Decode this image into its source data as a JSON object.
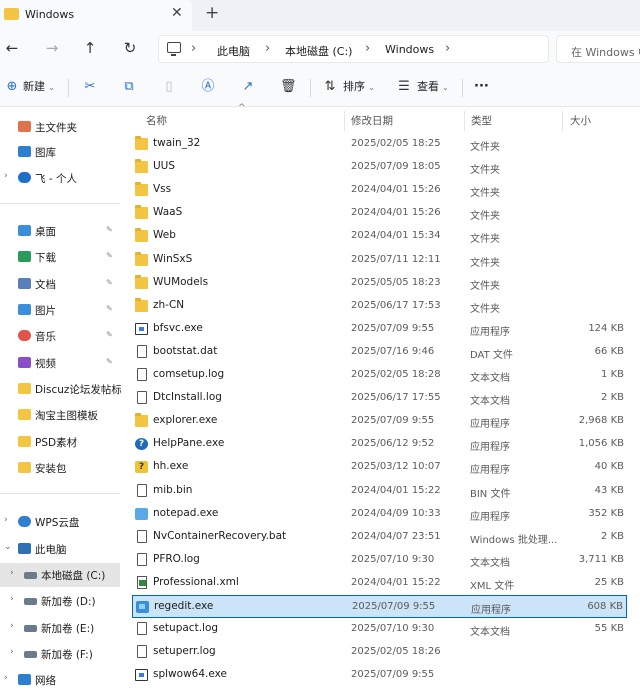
{
  "window": {
    "tab_title": "Windows",
    "tab_close": "✕",
    "tab_add": "+"
  },
  "nav": {
    "back_icon": "←",
    "forward_icon": "→",
    "up_icon": "↑",
    "refresh_icon": "↻"
  },
  "address": {
    "breadcrumbs": [
      "此电脑",
      "本地磁盘 (C:)",
      "Windows"
    ],
    "separator": "›"
  },
  "search": {
    "placeholder": "在 Windows 中搜索"
  },
  "toolbar": {
    "new_label": "新建",
    "sort_label": "排序",
    "view_label": "查看",
    "more_label": "···",
    "cut_icon": "✂",
    "copy_icon": "⧉",
    "paste_icon": "📋",
    "rename_icon": "Ⓐ",
    "share_icon": "↗",
    "delete_icon": "🗑"
  },
  "sidebar": {
    "items": [
      {
        "label": "主文件夹",
        "icon": "home-icon",
        "color": "#e0734a"
      },
      {
        "label": "图库",
        "icon": "gallery-icon",
        "color": "#2f7fd1"
      },
      {
        "label": "飞 - 个人",
        "icon": "onedrive-icon",
        "color": "#1e6fc6",
        "expander": "›"
      },
      {
        "label": "桌面",
        "icon": "desktop-icon",
        "color": "#3a8fd8",
        "pinned": true
      },
      {
        "label": "下载",
        "icon": "download-icon",
        "color": "#2b9a5a",
        "pinned": true
      },
      {
        "label": "文档",
        "icon": "documents-icon",
        "color": "#5a7fb8",
        "pinned": true
      },
      {
        "label": "图片",
        "icon": "pictures-icon",
        "color": "#3a8fd8",
        "pinned": true
      },
      {
        "label": "音乐",
        "icon": "music-icon",
        "color": "#e0544a",
        "pinned": true
      },
      {
        "label": "视频",
        "icon": "videos-icon",
        "color": "#8a4fc8",
        "pinned": true
      },
      {
        "label": "Discuz论坛发帖标题",
        "icon": "folder-icon",
        "color": "#f4c542"
      },
      {
        "label": "淘宝主图模板",
        "icon": "folder-icon",
        "color": "#f4c542"
      },
      {
        "label": "PSD素材",
        "icon": "folder-icon",
        "color": "#f4c542"
      },
      {
        "label": "安装包",
        "icon": "folder-icon",
        "color": "#f4c542"
      },
      {
        "label": "WPS云盘",
        "icon": "cloud-icon",
        "color": "#2f7fd1",
        "expander": "›"
      },
      {
        "label": "此电脑",
        "icon": "pc-icon",
        "color": "#2f6fb5",
        "expander": "⌄"
      },
      {
        "label": "本地磁盘 (C:)",
        "icon": "drive-icon",
        "color": "#6a7b8c",
        "expander": "›",
        "selected": true
      },
      {
        "label": "新加卷 (D:)",
        "icon": "drive-icon",
        "color": "#6a7b8c",
        "expander": "›"
      },
      {
        "label": "新加卷 (E:)",
        "icon": "drive-icon",
        "color": "#6a7b8c",
        "expander": "›"
      },
      {
        "label": "新加卷 (F:)",
        "icon": "drive-icon",
        "color": "#6a7b8c",
        "expander": "›"
      },
      {
        "label": "网络",
        "icon": "network-icon",
        "color": "#2f7fd1",
        "expander": "›"
      }
    ],
    "pin_icon": "📌"
  },
  "list": {
    "columns": {
      "name": "名称",
      "modified": "修改日期",
      "type": "类型",
      "size": "大小"
    },
    "sort_caret": "^",
    "rows": [
      {
        "name": "twain_32",
        "date": "2025/02/05 18:25",
        "type": "文件夹",
        "size": "",
        "icon": "folder"
      },
      {
        "name": "UUS",
        "date": "2025/07/09 18:05",
        "type": "文件夹",
        "size": "",
        "icon": "folder"
      },
      {
        "name": "Vss",
        "date": "2024/04/01 15:26",
        "type": "文件夹",
        "size": "",
        "icon": "folder"
      },
      {
        "name": "WaaS",
        "date": "2024/04/01 15:26",
        "type": "文件夹",
        "size": "",
        "icon": "folder"
      },
      {
        "name": "Web",
        "date": "2024/04/01 15:34",
        "type": "文件夹",
        "size": "",
        "icon": "folder"
      },
      {
        "name": "WinSxS",
        "date": "2025/07/11 12:11",
        "type": "文件夹",
        "size": "",
        "icon": "folder"
      },
      {
        "name": "WUModels",
        "date": "2025/05/05 18:23",
        "type": "文件夹",
        "size": "",
        "icon": "folder"
      },
      {
        "name": "zh-CN",
        "date": "2025/06/17 17:53",
        "type": "文件夹",
        "size": "",
        "icon": "folder"
      },
      {
        "name": "bfsvc.exe",
        "date": "2025/07/09 9:55",
        "type": "应用程序",
        "size": "124 KB",
        "icon": "exe"
      },
      {
        "name": "bootstat.dat",
        "date": "2025/07/16 9:46",
        "type": "DAT 文件",
        "size": "66 KB",
        "icon": "file"
      },
      {
        "name": "comsetup.log",
        "date": "2025/02/05 18:28",
        "type": "文本文档",
        "size": "1 KB",
        "icon": "file"
      },
      {
        "name": "DtcInstall.log",
        "date": "2025/06/17 17:55",
        "type": "文本文档",
        "size": "2 KB",
        "icon": "file"
      },
      {
        "name": "explorer.exe",
        "date": "2025/07/09 9:55",
        "type": "应用程序",
        "size": "2,968 KB",
        "icon": "folder"
      },
      {
        "name": "HelpPane.exe",
        "date": "2025/06/12 9:52",
        "type": "应用程序",
        "size": "1,056 KB",
        "icon": "help"
      },
      {
        "name": "hh.exe",
        "date": "2025/03/12 10:07",
        "type": "应用程序",
        "size": "40 KB",
        "icon": "hh"
      },
      {
        "name": "mib.bin",
        "date": "2024/04/01 15:22",
        "type": "BIN 文件",
        "size": "43 KB",
        "icon": "file"
      },
      {
        "name": "notepad.exe",
        "date": "2024/04/09 10:33",
        "type": "应用程序",
        "size": "352 KB",
        "icon": "notepad"
      },
      {
        "name": "NvContainerRecovery.bat",
        "date": "2024/04/07 23:51",
        "type": "Windows 批处理...",
        "size": "2 KB",
        "icon": "file"
      },
      {
        "name": "PFRO.log",
        "date": "2025/07/10 9:30",
        "type": "文本文档",
        "size": "3,711 KB",
        "icon": "file"
      },
      {
        "name": "Professional.xml",
        "date": "2024/04/01 15:22",
        "type": "XML 文件",
        "size": "25 KB",
        "icon": "xml"
      },
      {
        "name": "regedit.exe",
        "date": "2025/07/09 9:55",
        "type": "应用程序",
        "size": "608 KB",
        "icon": "regedit",
        "selected": true
      },
      {
        "name": "setupact.log",
        "date": "2025/07/10 9:30",
        "type": "文本文档",
        "size": "55 KB",
        "icon": "file"
      },
      {
        "name": "setuperr.log",
        "date": "2025/02/05 18:26",
        "type": "",
        "size": "",
        "icon": "file"
      },
      {
        "name": "splwow64.exe",
        "date": "2025/07/09 9:55",
        "type": "",
        "size": "",
        "icon": "exe"
      }
    ]
  }
}
